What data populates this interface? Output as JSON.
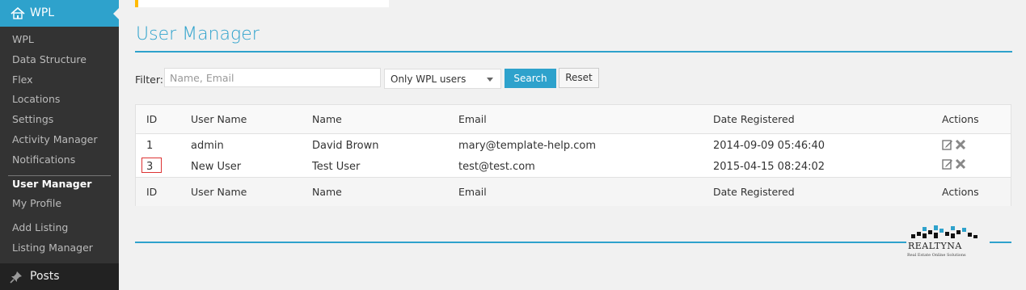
{
  "sidebar": {
    "header": "WPL",
    "items": [
      {
        "label": "WPL"
      },
      {
        "label": "Data Structure"
      },
      {
        "label": "Flex"
      },
      {
        "label": "Locations"
      },
      {
        "label": "Settings"
      },
      {
        "label": "Activity Manager"
      },
      {
        "label": "Notifications"
      },
      {
        "label": "User Manager"
      },
      {
        "label": "My Profile"
      },
      {
        "label": "Add Listing"
      },
      {
        "label": "Listing Manager"
      }
    ],
    "posts_label": "Posts"
  },
  "page": {
    "title": "User Manager"
  },
  "filter": {
    "label": "Filter:",
    "placeholder": "Name, Email",
    "select_value": "Only WPL users",
    "search_label": "Search",
    "reset_label": "Reset"
  },
  "table": {
    "headers": {
      "id": "ID",
      "user_name": "User Name",
      "name": "Name",
      "email": "Email",
      "date": "Date Registered",
      "actions": "Actions"
    },
    "rows": [
      {
        "id": "1",
        "user_name": "admin",
        "name": "David Brown",
        "email": "mary@template-help.com",
        "date": "2014-09-09 05:46:40"
      },
      {
        "id": "3",
        "user_name": "New User",
        "name": "Test User",
        "email": "test@test.com",
        "date": "2015-04-15 08:24:02"
      }
    ]
  },
  "footer": {
    "logo_word": "REALTYNA",
    "logo_tagline": "Real Estate Online Solutions"
  },
  "colors": {
    "accent": "#2ea2cc",
    "sidebar": "#222222",
    "link": "#0074a2"
  },
  "icons": {
    "menu": "house-icon",
    "posts": "pin-icon",
    "edit": "edit-icon",
    "delete": "delete-icon"
  }
}
